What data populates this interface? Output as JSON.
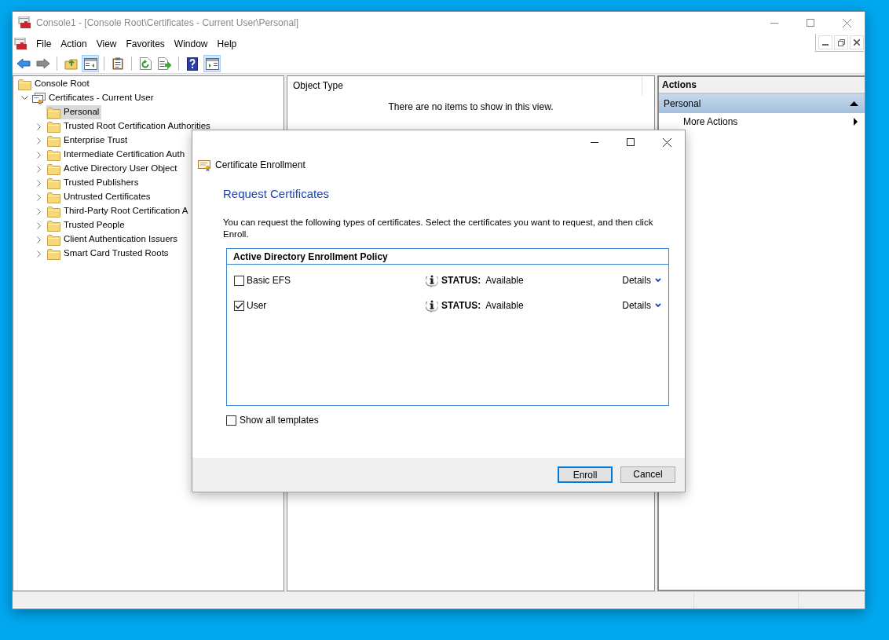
{
  "window": {
    "title": "Console1 - [Console Root\\Certificates - Current User\\Personal]"
  },
  "menu": [
    "File",
    "Action",
    "View",
    "Favorites",
    "Window",
    "Help"
  ],
  "toolbar": [
    {
      "kind": "back",
      "pressed": false
    },
    {
      "kind": "forward",
      "pressed": false
    },
    {
      "kind": "sep"
    },
    {
      "kind": "up",
      "pressed": false
    },
    {
      "kind": "tree",
      "pressed": true
    },
    {
      "kind": "sep"
    },
    {
      "kind": "clipboard",
      "pressed": false
    },
    {
      "kind": "sep"
    },
    {
      "kind": "refresh",
      "pressed": false
    },
    {
      "kind": "export",
      "pressed": false
    },
    {
      "kind": "sep"
    },
    {
      "kind": "help",
      "pressed": false
    },
    {
      "kind": "actionpane",
      "pressed": true
    }
  ],
  "tree": [
    {
      "label": "Console Root",
      "kind": "folder",
      "selected": false,
      "children": [
        {
          "label": "Certificates - Current User",
          "kind": "store",
          "expanded": true,
          "selected": false,
          "children": [
            {
              "label": "Personal",
              "kind": "folder",
              "selected": true
            },
            {
              "label": "Trusted Root Certification Authorities",
              "kind": "folder",
              "expanded": false,
              "selected": false
            },
            {
              "label": "Enterprise Trust",
              "kind": "folder",
              "expanded": false,
              "selected": false
            },
            {
              "label": "Intermediate Certification Auth",
              "kind": "folder",
              "expanded": false,
              "selected": false
            },
            {
              "label": "Active Directory User Object",
              "kind": "folder",
              "expanded": false,
              "selected": false
            },
            {
              "label": "Trusted Publishers",
              "kind": "folder",
              "expanded": false,
              "selected": false
            },
            {
              "label": "Untrusted Certificates",
              "kind": "folder",
              "expanded": false,
              "selected": false
            },
            {
              "label": "Third-Party Root Certification A",
              "kind": "folder",
              "expanded": false,
              "selected": false
            },
            {
              "label": "Trusted People",
              "kind": "folder",
              "expanded": false,
              "selected": false
            },
            {
              "label": "Client Authentication Issuers",
              "kind": "folder",
              "expanded": false,
              "selected": false
            },
            {
              "label": "Smart Card Trusted Roots",
              "kind": "folder",
              "expanded": false,
              "selected": false
            }
          ]
        }
      ]
    }
  ],
  "list": {
    "column_1": "Object Type",
    "empty_message": "There are no items to show in this view."
  },
  "actions": {
    "header": "Actions",
    "items": [
      {
        "kind": "group",
        "label": "Personal",
        "expanded": true
      },
      {
        "kind": "submenu",
        "label": "More Actions"
      }
    ]
  },
  "dialog": {
    "title": "Certificate Enrollment",
    "heading": "Request Certificates",
    "description": "You can request the following types of certificates. Select the certificates you want to request, and then click Enroll.",
    "policy": "Active Directory Enrollment Policy",
    "templates": [
      {
        "name": "Basic EFS",
        "checked": false,
        "status_label": "STATUS:",
        "status": "Available",
        "details": "Details"
      },
      {
        "name": "User",
        "checked": true,
        "status_label": "STATUS:",
        "status": "Available",
        "details": "Details"
      }
    ],
    "show_all": {
      "label": "Show all templates",
      "checked": false
    },
    "buttons": [
      {
        "label": "Enroll",
        "default": true
      },
      {
        "label": "Cancel",
        "default": false
      }
    ]
  }
}
